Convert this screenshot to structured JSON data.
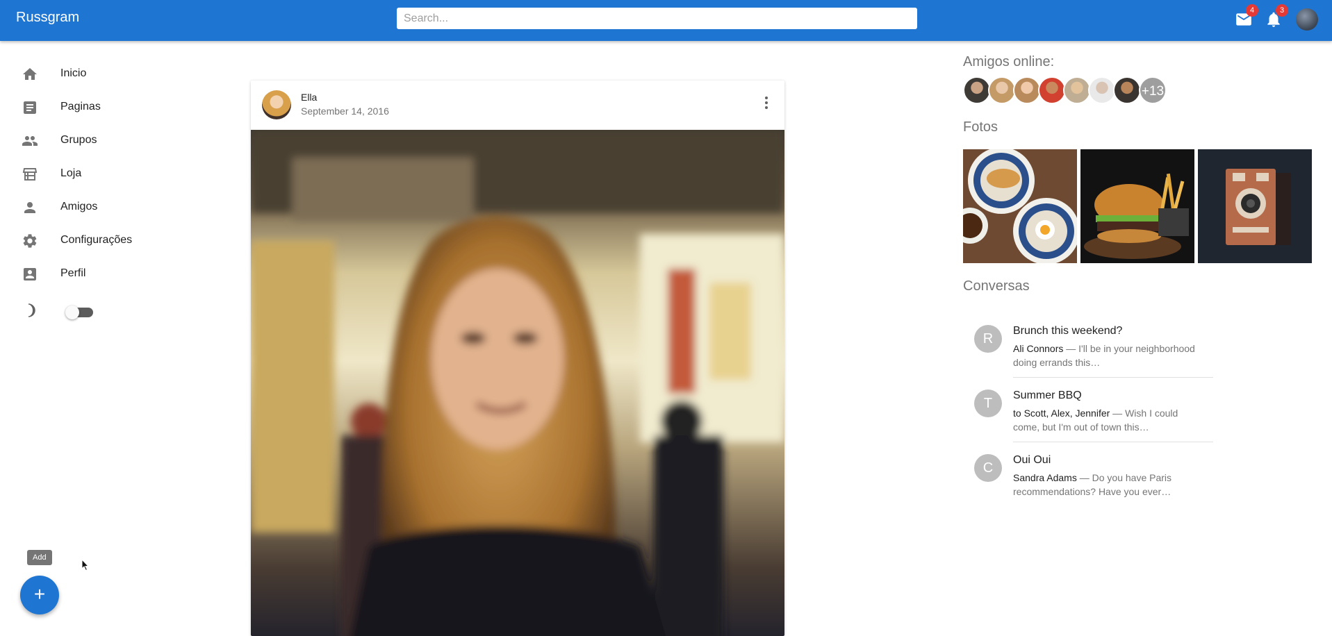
{
  "appbar": {
    "brand": "Russgram",
    "search_placeholder": "Search...",
    "mail_count": "4",
    "notifications_count": "3",
    "accent": "#1f76d2"
  },
  "sidebar": {
    "items": [
      {
        "label": "Inicio",
        "icon": "home-icon"
      },
      {
        "label": "Paginas",
        "icon": "pages-icon"
      },
      {
        "label": "Grupos",
        "icon": "groups-icon"
      },
      {
        "label": "Loja",
        "icon": "store-icon"
      },
      {
        "label": "Amigos",
        "icon": "person-icon"
      },
      {
        "label": "Configurações",
        "icon": "gear-icon"
      },
      {
        "label": "Perfil",
        "icon": "profile-card-icon"
      }
    ],
    "dark_mode_on": false
  },
  "fab": {
    "tooltip": "Add",
    "icon": "+"
  },
  "post": {
    "author": "Ella",
    "date": "September 14, 2016"
  },
  "right": {
    "online_title": "Amigos online:",
    "online_more": "+13",
    "photos_title": "Fotos",
    "conversations_title": "Conversas",
    "conversations": [
      {
        "initial": "R",
        "title": "Brunch this weekend?",
        "who": "Ali Connors",
        "text": " — I'll be in your neighborhood doing errands this…"
      },
      {
        "initial": "T",
        "title": "Summer BBQ",
        "who": "to Scott, Alex, Jennifer",
        "text": " — Wish I could come, but I'm out of town this…"
      },
      {
        "initial": "C",
        "title": "Oui Oui",
        "who": "Sandra Adams",
        "text": " — Do you have Paris recommendations? Have you ever…"
      }
    ]
  }
}
